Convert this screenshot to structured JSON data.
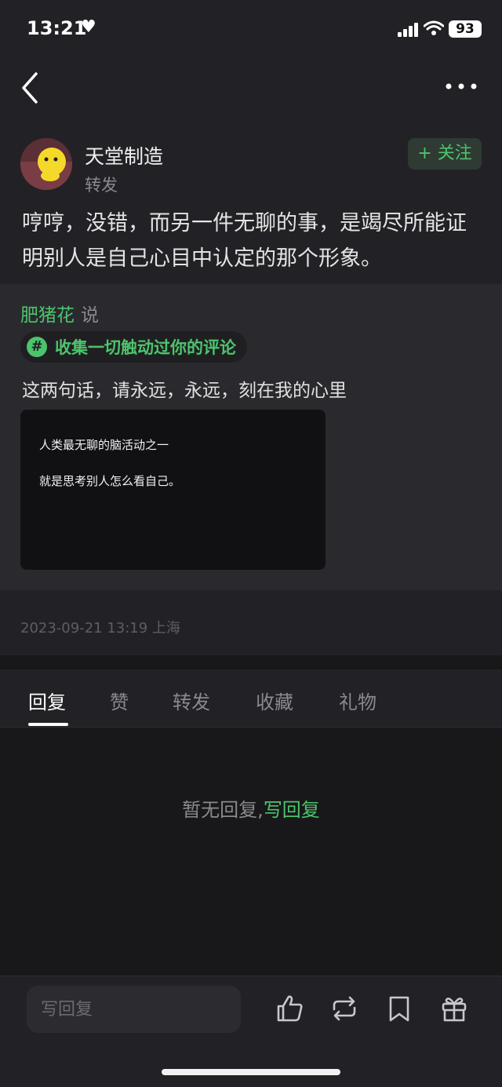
{
  "status_bar": {
    "time": "13:21",
    "battery": "93"
  },
  "post": {
    "author": "天堂制造",
    "type": "转发",
    "follow_label": "+ 关注",
    "text": "哼哼，没错，而另一件无聊的事，是竭尽所能证明别人是自己心目中认定的那个形象。"
  },
  "quote": {
    "author": "肥猪花",
    "says": "说",
    "tag_icon": "#",
    "tag": "收集一切触动过你的评论",
    "text": "这两句话，请永远，永远，刻在我的心里",
    "image_lines": [
      "人类最无聊的脑活动之一",
      "就是思考别人怎么看自己。"
    ]
  },
  "timestamp": "2023-09-21 13:19 上海",
  "tabs": [
    {
      "label": "回复",
      "active": true
    },
    {
      "label": "赞",
      "active": false
    },
    {
      "label": "转发",
      "active": false
    },
    {
      "label": "收藏",
      "active": false
    },
    {
      "label": "礼物",
      "active": false
    }
  ],
  "empty_state": {
    "text": "暂无回复,",
    "link": "写回复"
  },
  "bottom_bar": {
    "reply_placeholder": "写回复"
  },
  "colors": {
    "accent": "#4cc46c",
    "background": "#18181b",
    "surface": "#222226"
  },
  "icons": [
    "back-icon",
    "more-icon",
    "like-icon",
    "repost-icon",
    "bookmark-icon",
    "gift-icon"
  ]
}
